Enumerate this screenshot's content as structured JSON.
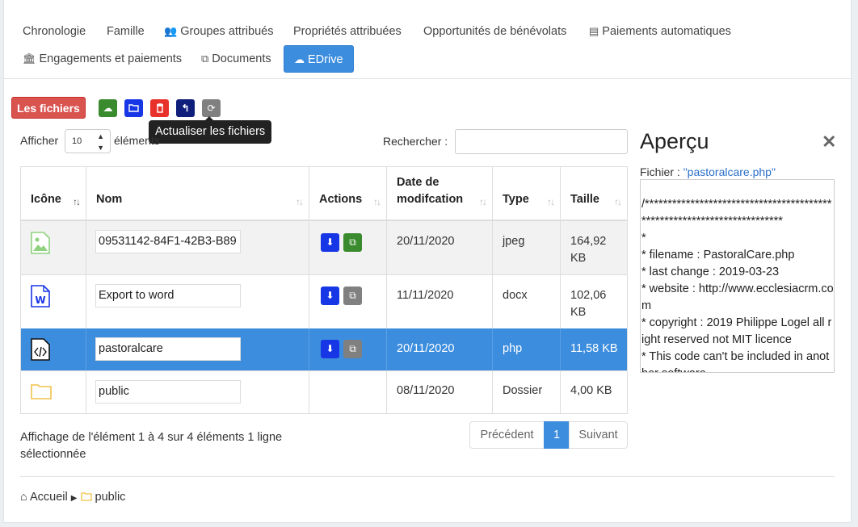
{
  "tabs": [
    {
      "label": "Chronologie",
      "icon": ""
    },
    {
      "label": "Famille",
      "icon": ""
    },
    {
      "label": "Groupes attribués",
      "icon": "users-icon"
    },
    {
      "label": "Propriétés attribuées",
      "icon": ""
    },
    {
      "label": "Opportunités de bénévolats",
      "icon": ""
    },
    {
      "label": "Paiements automatiques",
      "icon": "credit-card-icon"
    },
    {
      "label": "Engagements et paiements",
      "icon": "bank-icon"
    },
    {
      "label": "Documents",
      "icon": "copy-icon"
    },
    {
      "label": "EDrive",
      "icon": "cloud-icon",
      "active": true
    }
  ],
  "toolbar": {
    "files_label": "Les fichiers",
    "tooltip": "Actualiser les fichiers",
    "buttons": [
      {
        "name": "upload",
        "color": "#3a8a2e"
      },
      {
        "name": "new-folder",
        "color": "#1736e6"
      },
      {
        "name": "delete",
        "color": "#e8312a"
      },
      {
        "name": "folder-up",
        "color": "#0f1e7a"
      },
      {
        "name": "refresh",
        "color": "#808080"
      }
    ]
  },
  "controls": {
    "show_label": "Afficher",
    "page_length": "10",
    "show_after": "éléments",
    "search_label": "Rechercher :",
    "search_value": ""
  },
  "table": {
    "headers": [
      "Icône",
      "Nom",
      "Actions",
      "Date de modifcation",
      "Type",
      "Taille"
    ],
    "rows": [
      {
        "icon": "image-file-icon",
        "name": "09531142-84F1-42B3-B89",
        "date": "20/11/2020",
        "type": "jpeg",
        "size": "164,92 KB",
        "share_color": "#3a8a2e",
        "selected": false
      },
      {
        "icon": "word-file-icon",
        "name": "Export to word",
        "date": "11/11/2020",
        "type": "docx",
        "size": "102,06 KB",
        "share_color": "#808080",
        "selected": false
      },
      {
        "icon": "code-file-icon",
        "name": "pastoralcare",
        "date": "20/11/2020",
        "type": "php",
        "size": "11,58 KB",
        "share_color": "#808080",
        "selected": true
      },
      {
        "icon": "folder-icon",
        "name": "public",
        "date": "08/11/2020",
        "type": "Dossier",
        "size": "4,00 KB",
        "share_color": null,
        "selected": false
      }
    ]
  },
  "footer": {
    "info": "Affichage de l'élément 1 à 4 sur 4 éléments    1 ligne sélectionnée",
    "prev": "Précédent",
    "page": "1",
    "next": "Suivant"
  },
  "breadcrumb": {
    "home": "Accueil",
    "folder": "public"
  },
  "preview": {
    "title": "Aperçu",
    "file_label": "Fichier :",
    "file_name": "\"pastoralcare.php\"",
    "content": "/************************************************************************\n*\n* filename : PastoralCare.php\n* last change : 2019-03-23\n* website : http://www.ecclesiacrm.com\n* copyright : 2019 Philippe Logel all right reserved not MIT licence\n* This code can't be included in another software"
  }
}
